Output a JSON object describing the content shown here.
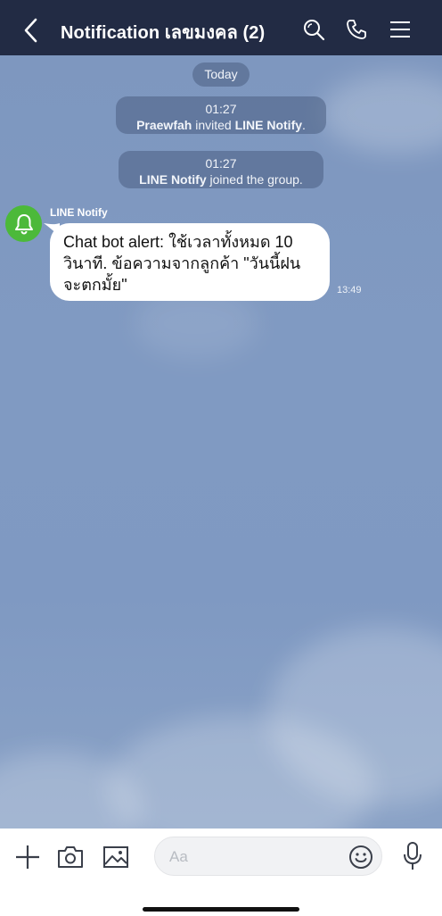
{
  "header": {
    "title": "Notification เลขมงคล (2)",
    "icons": [
      "back-chevron-icon",
      "search-icon",
      "phone-icon",
      "menu-icon"
    ]
  },
  "chat": {
    "date_label": "Today",
    "system_messages": [
      {
        "time": "01:27",
        "actor": "Praewfah",
        "action": " invited ",
        "target": "LINE Notify",
        "end": "."
      },
      {
        "time": "01:27",
        "actor": "LINE Notify",
        "action": " joined the group.",
        "target": "",
        "end": ""
      }
    ],
    "message": {
      "sender": "LINE Notify",
      "avatar_icon": "bell-icon",
      "text": "Chat bot alert: ใช้เวลาทั้งหมด 10 วินาที. ข้อความจากลูกค้า \"วันนี้ฝนจะตกมั้ย\"",
      "time": "13:49"
    }
  },
  "input_bar": {
    "placeholder": "Aa",
    "icons": [
      "plus-icon",
      "camera-icon",
      "image-icon",
      "emoji-icon",
      "microphone-icon"
    ]
  },
  "colors": {
    "header_bg": "#222b44",
    "chat_bg": "#809ac2",
    "avatar_green": "#4cb93a"
  }
}
